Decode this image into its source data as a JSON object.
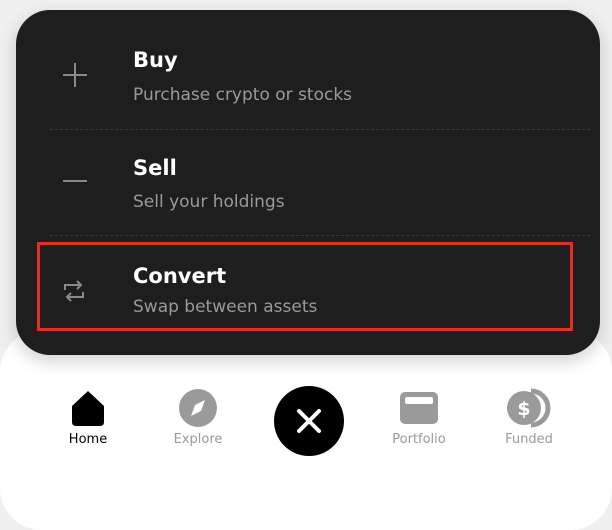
{
  "menu": {
    "items": [
      {
        "title": "Buy",
        "subtitle": "Purchase crypto or stocks",
        "icon": "plus-icon"
      },
      {
        "title": "Sell",
        "subtitle": "Sell your holdings",
        "icon": "minus-icon"
      },
      {
        "title": "Convert",
        "subtitle": "Swap between assets",
        "icon": "convert-arrows-icon"
      }
    ]
  },
  "nav": {
    "items": [
      {
        "label": "Home",
        "icon": "home-icon",
        "active": true
      },
      {
        "label": "Explore",
        "icon": "compass-icon",
        "active": false
      },
      {
        "label": "Portfolio",
        "icon": "wallet-icon",
        "active": false
      },
      {
        "label": "Funded",
        "icon": "funded-coin-icon",
        "active": false
      }
    ],
    "center_button_icon": "close-icon"
  },
  "colors": {
    "menu_background": "#1e1e1e",
    "highlight": "#e0301e",
    "nav_active": "#000000",
    "nav_inactive": "#9a9a9a"
  }
}
